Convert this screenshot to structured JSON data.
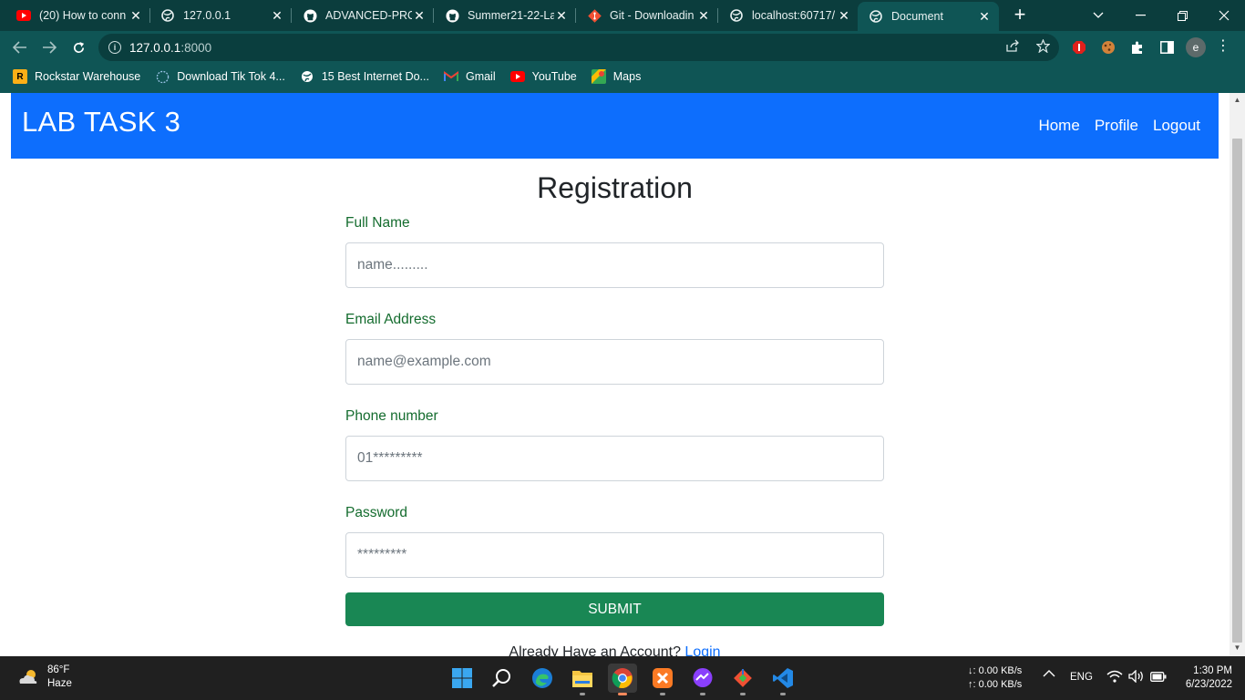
{
  "browser": {
    "tabs": [
      {
        "title": "(20) How to conn",
        "icon": "youtube-icon"
      },
      {
        "title": "127.0.0.1",
        "icon": "globe-icon"
      },
      {
        "title": "ADVANCED-PRO",
        "icon": "github-icon"
      },
      {
        "title": "Summer21-22-La",
        "icon": "github-icon"
      },
      {
        "title": "Git - Downloadin",
        "icon": "git-icon"
      },
      {
        "title": "localhost:60717/",
        "icon": "globe-icon"
      },
      {
        "title": "Document",
        "icon": "globe-icon",
        "active": true
      }
    ],
    "new_tab": "+",
    "address": {
      "host": "127.0.0.1",
      "port": ":8000"
    },
    "profile_initial": "e",
    "bookmarks": [
      {
        "label": "Rockstar Warehouse",
        "icon": "rockstar-icon"
      },
      {
        "label": "Download Tik Tok 4...",
        "icon": "tiktok-globe-icon"
      },
      {
        "label": "15 Best Internet Do...",
        "icon": "globe-icon"
      },
      {
        "label": "Gmail",
        "icon": "gmail-icon"
      },
      {
        "label": "YouTube",
        "icon": "youtube-icon"
      },
      {
        "label": "Maps",
        "icon": "maps-icon"
      }
    ]
  },
  "page": {
    "brand": "LAB TASK 3",
    "nav": {
      "home": "Home",
      "profile": "Profile",
      "logout": "Logout"
    },
    "title": "Registration",
    "form": {
      "full_name": {
        "label": "Full Name",
        "placeholder": "name.........",
        "value": ""
      },
      "email": {
        "label": "Email Address",
        "placeholder": "name@example.com",
        "value": ""
      },
      "phone": {
        "label": "Phone number",
        "placeholder": "01*********",
        "value": ""
      },
      "password": {
        "label": "Password",
        "placeholder": "*********",
        "value": ""
      },
      "submit": "SUBMIT"
    },
    "account_prompt": "Already Have an Account?",
    "login_link": "Login"
  },
  "colors": {
    "navbar": "#0d6efd",
    "label_green": "#146c2e",
    "submit_green": "#198754",
    "browser_frame": "#0f5555"
  },
  "taskbar": {
    "weather": {
      "temp": "86°F",
      "condition": "Haze"
    },
    "net": {
      "down": "↓: 0.00 KB/s",
      "up": "↑: 0.00 KB/s"
    },
    "language": "ENG",
    "time": "1:30 PM",
    "date": "6/23/2022",
    "apps": [
      "windows-start-icon",
      "search-icon",
      "edge-icon",
      "file-explorer-icon",
      "chrome-icon",
      "xampp-icon",
      "messenger-icon",
      "git-gui-icon",
      "vscode-icon"
    ]
  }
}
